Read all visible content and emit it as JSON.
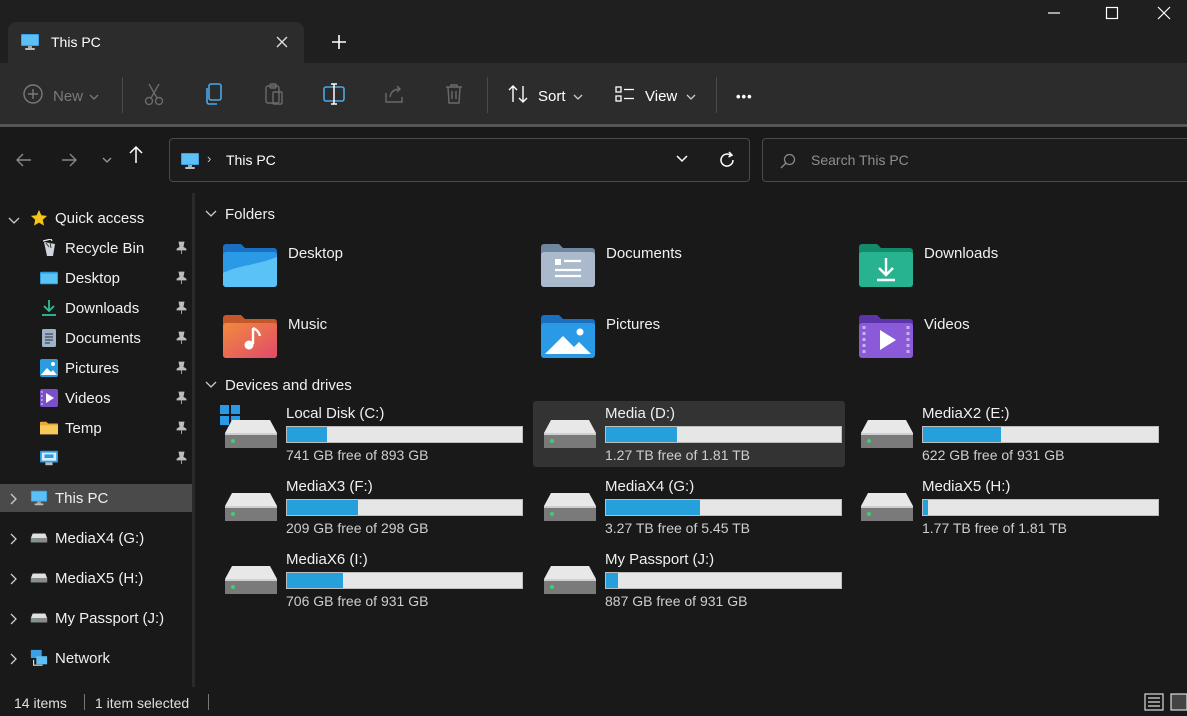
{
  "window": {
    "tab_title": "This PC",
    "icons": [
      "monitor-icon",
      "close-icon",
      "plus-icon",
      "minimize-icon",
      "maximize-icon",
      "close-window-icon"
    ]
  },
  "toolbar": {
    "new_label": "New",
    "sort_label": "Sort",
    "view_label": "View",
    "more_label": "•••",
    "icons": [
      "new-plus-icon",
      "cut-icon",
      "copy-icon",
      "paste-icon",
      "rename-icon",
      "share-icon",
      "delete-icon",
      "sort-icon",
      "view-icon"
    ]
  },
  "address": {
    "crumb": "This PC",
    "separator": "›"
  },
  "search": {
    "placeholder": "Search This PC"
  },
  "sidebar": {
    "quick_access": "Quick access",
    "items": [
      {
        "label": "Recycle Bin",
        "icon": "recycle-bin-icon"
      },
      {
        "label": "Desktop",
        "icon": "desktop-folder-icon"
      },
      {
        "label": "Downloads",
        "icon": "download-icon"
      },
      {
        "label": "Documents",
        "icon": "document-icon"
      },
      {
        "label": "Pictures",
        "icon": "pictures-icon"
      },
      {
        "label": "Videos",
        "icon": "video-icon"
      },
      {
        "label": "Temp",
        "icon": "folder-icon"
      },
      {
        "label": "",
        "icon": "monitor-small-icon"
      }
    ],
    "roots": [
      {
        "label": "This PC",
        "icon": "monitor-icon"
      },
      {
        "label": "MediaX4 (G:)",
        "icon": "drive-icon"
      },
      {
        "label": "MediaX5 (H:)",
        "icon": "drive-icon"
      },
      {
        "label": "My Passport (J:)",
        "icon": "drive-icon"
      },
      {
        "label": "Network",
        "icon": "network-icon"
      }
    ]
  },
  "folders": {
    "heading": "Folders",
    "items": [
      {
        "name": "Desktop",
        "icon": "desktop-folder-icon"
      },
      {
        "name": "Documents",
        "icon": "documents-folder-icon"
      },
      {
        "name": "Downloads",
        "icon": "downloads-folder-icon"
      },
      {
        "name": "Music",
        "icon": "music-folder-icon"
      },
      {
        "name": "Pictures",
        "icon": "pictures-folder-icon"
      },
      {
        "name": "Videos",
        "icon": "videos-folder-icon"
      }
    ]
  },
  "drives": {
    "heading": "Devices and drives",
    "items": [
      {
        "name": "Local Disk (C:)",
        "free": "741 GB free of 893 GB",
        "used_fraction": 0.17
      },
      {
        "name": "Media (D:)",
        "free": "1.27 TB free of 1.81 TB",
        "used_fraction": 0.3
      },
      {
        "name": "MediaX2 (E:)",
        "free": "622 GB free of 931 GB",
        "used_fraction": 0.33
      },
      {
        "name": "MediaX3 (F:)",
        "free": "209 GB free of 298 GB",
        "used_fraction": 0.3
      },
      {
        "name": "MediaX4 (G:)",
        "free": "3.27 TB free of 5.45 TB",
        "used_fraction": 0.4
      },
      {
        "name": "MediaX5 (H:)",
        "free": "1.77 TB free of 1.81 TB",
        "used_fraction": 0.02
      },
      {
        "name": "MediaX6 (I:)",
        "free": "706 GB free of 931 GB",
        "used_fraction": 0.24
      },
      {
        "name": "My Passport (J:)",
        "free": "887 GB free of 931 GB",
        "used_fraction": 0.05
      }
    ]
  },
  "status": {
    "items_count": "14 items",
    "selection": "1 item selected"
  },
  "colors": {
    "accent": "#26a0da",
    "background": "#191919",
    "toolbar": "#2c2c2c"
  }
}
